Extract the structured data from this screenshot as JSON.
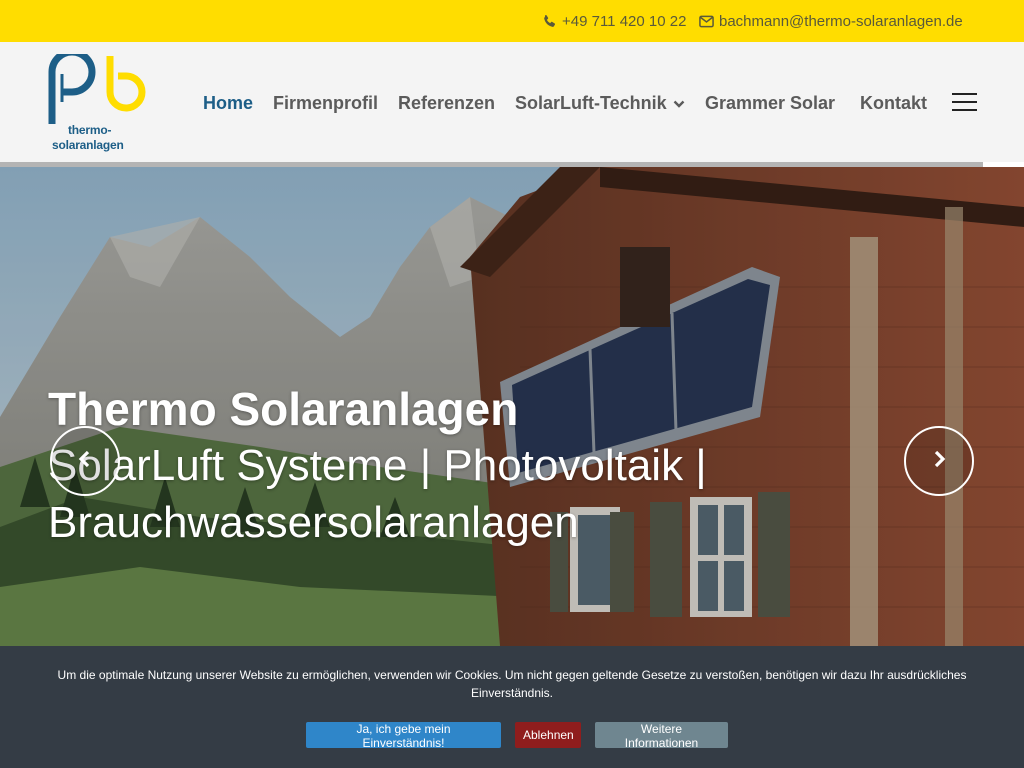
{
  "topbar": {
    "phone": "+49 711 420 10 22",
    "email": "bachmann@thermo-solaranlagen.de"
  },
  "logo": {
    "line1": "thermo-",
    "line2": "solaranlagen"
  },
  "nav": {
    "items": [
      {
        "label": "Home",
        "active": true
      },
      {
        "label": "Firmenprofil"
      },
      {
        "label": "Referenzen"
      },
      {
        "label": "SolarLuft-Technik",
        "has_dropdown": true
      },
      {
        "label": "Grammer Solar"
      },
      {
        "label": "Kontakt"
      }
    ]
  },
  "hero": {
    "title": "Thermo Solaranlagen",
    "subtitle": "SolarLuft Systeme | Photovoltaik | Brauchwassersolaranlagen"
  },
  "cookie": {
    "text": "Um die optimale Nutzung unserer Website zu ermöglichen, verwenden wir Cookies. Um nicht gegen geltende Gesetze zu verstoßen, benötigen wir dazu Ihr ausdrückliches Einverständnis.",
    "accept_label": "Ja, ich gebe mein Einverständnis!",
    "decline_label": "Ablehnen",
    "info_label": "Weitere Informationen"
  },
  "colors": {
    "topbar": "#ffdd00",
    "brand_blue": "#1d5e87",
    "logo_yellow": "#ffdd00",
    "accept": "#2f86c9",
    "decline": "#8f1d1d",
    "info": "#6f8690",
    "cookie_bg": "#343c45"
  },
  "icons": [
    "phone-icon",
    "envelope-icon",
    "chevron-down-icon",
    "hamburger-icon",
    "chevron-left-icon",
    "chevron-right-icon"
  ]
}
